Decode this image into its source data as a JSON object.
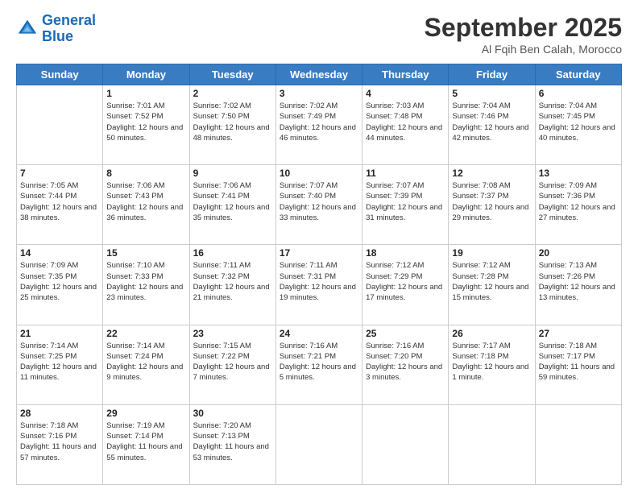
{
  "header": {
    "logo_line1": "General",
    "logo_line2": "Blue",
    "month_title": "September 2025",
    "subtitle": "Al Fqih Ben Calah, Morocco"
  },
  "weekdays": [
    "Sunday",
    "Monday",
    "Tuesday",
    "Wednesday",
    "Thursday",
    "Friday",
    "Saturday"
  ],
  "weeks": [
    [
      {
        "day": "",
        "info": ""
      },
      {
        "day": "1",
        "info": "Sunrise: 7:01 AM\nSunset: 7:52 PM\nDaylight: 12 hours\nand 50 minutes."
      },
      {
        "day": "2",
        "info": "Sunrise: 7:02 AM\nSunset: 7:50 PM\nDaylight: 12 hours\nand 48 minutes."
      },
      {
        "day": "3",
        "info": "Sunrise: 7:02 AM\nSunset: 7:49 PM\nDaylight: 12 hours\nand 46 minutes."
      },
      {
        "day": "4",
        "info": "Sunrise: 7:03 AM\nSunset: 7:48 PM\nDaylight: 12 hours\nand 44 minutes."
      },
      {
        "day": "5",
        "info": "Sunrise: 7:04 AM\nSunset: 7:46 PM\nDaylight: 12 hours\nand 42 minutes."
      },
      {
        "day": "6",
        "info": "Sunrise: 7:04 AM\nSunset: 7:45 PM\nDaylight: 12 hours\nand 40 minutes."
      }
    ],
    [
      {
        "day": "7",
        "info": "Sunrise: 7:05 AM\nSunset: 7:44 PM\nDaylight: 12 hours\nand 38 minutes."
      },
      {
        "day": "8",
        "info": "Sunrise: 7:06 AM\nSunset: 7:43 PM\nDaylight: 12 hours\nand 36 minutes."
      },
      {
        "day": "9",
        "info": "Sunrise: 7:06 AM\nSunset: 7:41 PM\nDaylight: 12 hours\nand 35 minutes."
      },
      {
        "day": "10",
        "info": "Sunrise: 7:07 AM\nSunset: 7:40 PM\nDaylight: 12 hours\nand 33 minutes."
      },
      {
        "day": "11",
        "info": "Sunrise: 7:07 AM\nSunset: 7:39 PM\nDaylight: 12 hours\nand 31 minutes."
      },
      {
        "day": "12",
        "info": "Sunrise: 7:08 AM\nSunset: 7:37 PM\nDaylight: 12 hours\nand 29 minutes."
      },
      {
        "day": "13",
        "info": "Sunrise: 7:09 AM\nSunset: 7:36 PM\nDaylight: 12 hours\nand 27 minutes."
      }
    ],
    [
      {
        "day": "14",
        "info": "Sunrise: 7:09 AM\nSunset: 7:35 PM\nDaylight: 12 hours\nand 25 minutes."
      },
      {
        "day": "15",
        "info": "Sunrise: 7:10 AM\nSunset: 7:33 PM\nDaylight: 12 hours\nand 23 minutes."
      },
      {
        "day": "16",
        "info": "Sunrise: 7:11 AM\nSunset: 7:32 PM\nDaylight: 12 hours\nand 21 minutes."
      },
      {
        "day": "17",
        "info": "Sunrise: 7:11 AM\nSunset: 7:31 PM\nDaylight: 12 hours\nand 19 minutes."
      },
      {
        "day": "18",
        "info": "Sunrise: 7:12 AM\nSunset: 7:29 PM\nDaylight: 12 hours\nand 17 minutes."
      },
      {
        "day": "19",
        "info": "Sunrise: 7:12 AM\nSunset: 7:28 PM\nDaylight: 12 hours\nand 15 minutes."
      },
      {
        "day": "20",
        "info": "Sunrise: 7:13 AM\nSunset: 7:26 PM\nDaylight: 12 hours\nand 13 minutes."
      }
    ],
    [
      {
        "day": "21",
        "info": "Sunrise: 7:14 AM\nSunset: 7:25 PM\nDaylight: 12 hours\nand 11 minutes."
      },
      {
        "day": "22",
        "info": "Sunrise: 7:14 AM\nSunset: 7:24 PM\nDaylight: 12 hours\nand 9 minutes."
      },
      {
        "day": "23",
        "info": "Sunrise: 7:15 AM\nSunset: 7:22 PM\nDaylight: 12 hours\nand 7 minutes."
      },
      {
        "day": "24",
        "info": "Sunrise: 7:16 AM\nSunset: 7:21 PM\nDaylight: 12 hours\nand 5 minutes."
      },
      {
        "day": "25",
        "info": "Sunrise: 7:16 AM\nSunset: 7:20 PM\nDaylight: 12 hours\nand 3 minutes."
      },
      {
        "day": "26",
        "info": "Sunrise: 7:17 AM\nSunset: 7:18 PM\nDaylight: 12 hours\nand 1 minute."
      },
      {
        "day": "27",
        "info": "Sunrise: 7:18 AM\nSunset: 7:17 PM\nDaylight: 11 hours\nand 59 minutes."
      }
    ],
    [
      {
        "day": "28",
        "info": "Sunrise: 7:18 AM\nSunset: 7:16 PM\nDaylight: 11 hours\nand 57 minutes."
      },
      {
        "day": "29",
        "info": "Sunrise: 7:19 AM\nSunset: 7:14 PM\nDaylight: 11 hours\nand 55 minutes."
      },
      {
        "day": "30",
        "info": "Sunrise: 7:20 AM\nSunset: 7:13 PM\nDaylight: 11 hours\nand 53 minutes."
      },
      {
        "day": "",
        "info": ""
      },
      {
        "day": "",
        "info": ""
      },
      {
        "day": "",
        "info": ""
      },
      {
        "day": "",
        "info": ""
      }
    ]
  ]
}
